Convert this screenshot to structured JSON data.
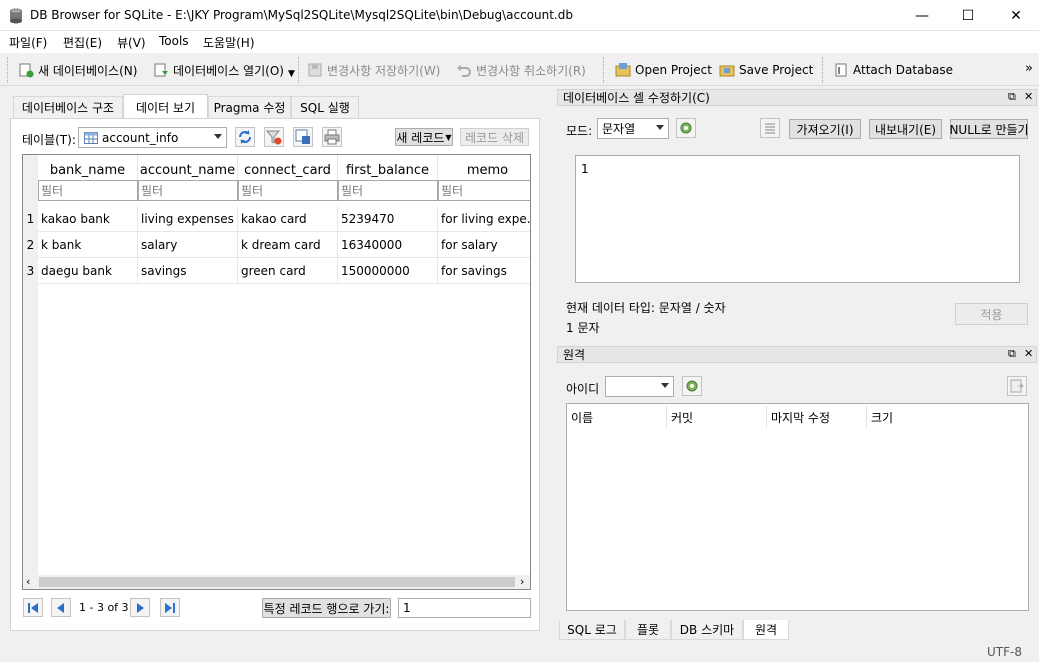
{
  "window": {
    "title": "DB Browser for SQLite - E:\\JKY Program\\MySql2SQLite\\Mysql2SQLite\\bin\\Debug\\account.db",
    "minimize": "—",
    "maximize": "☐",
    "close": "✕"
  },
  "menu": {
    "items": [
      "파일(F)",
      "편집(E)",
      "뷰(V)",
      "Tools",
      "도움말(H)"
    ]
  },
  "toolbar": {
    "new_db": "새 데이터베이스(N)",
    "open_db": "데이터베이스 열기(O)",
    "write_changes": "변경사항 저장하기(W)",
    "revert_changes": "변경사항 취소하기(R)",
    "open_project": "Open Project",
    "save_project": "Save Project",
    "attach_db": "Attach Database",
    "overflow": "»"
  },
  "tabs": [
    "데이터베이스 구조",
    "데이터 보기",
    "Pragma 수정",
    "SQL 실행"
  ],
  "browse": {
    "table_label": "테이블(T):",
    "table_value": "account_info",
    "new_record": "새 레코드",
    "delete_record": "레코드 삭제",
    "columns": [
      "bank_name",
      "account_name",
      "connect_card",
      "first_balance",
      "memo"
    ],
    "filter_placeholder": "필터",
    "rows": [
      {
        "num": "1",
        "cells": [
          "kakao bank",
          "living expenses",
          "kakao card",
          "5239470",
          "for living expe..."
        ]
      },
      {
        "num": "2",
        "cells": [
          "k bank",
          "salary",
          "k dream card",
          "16340000",
          "for salary"
        ]
      },
      {
        "num": "3",
        "cells": [
          "daegu bank",
          "savings",
          "green card",
          "150000000",
          "for savings"
        ]
      }
    ],
    "record_count": "1 - 3 of 3",
    "goto_label": "특정 레코드 행으로 가기:",
    "goto_value": "1"
  },
  "edit_cell": {
    "title": "데이터베이스 셀 수정하기(C)",
    "mode_label": "모드:",
    "mode_value": "문자열",
    "import": "가져오기(I)",
    "export": "내보내기(E)",
    "set_null": "NULL로 만들기",
    "content": "1",
    "type_info": "현재 데이터 타입: 문자열 / 숫자",
    "size_info": "1 문자",
    "apply": "적용"
  },
  "remote": {
    "title": "원격",
    "identity_label": "아이디",
    "columns": [
      "이름",
      "커밋",
      "마지막 수정",
      "크기"
    ]
  },
  "bottom_tabs": [
    "SQL 로그",
    "플롯",
    "DB 스키마",
    "원격"
  ],
  "status": {
    "encoding": "UTF-8"
  }
}
